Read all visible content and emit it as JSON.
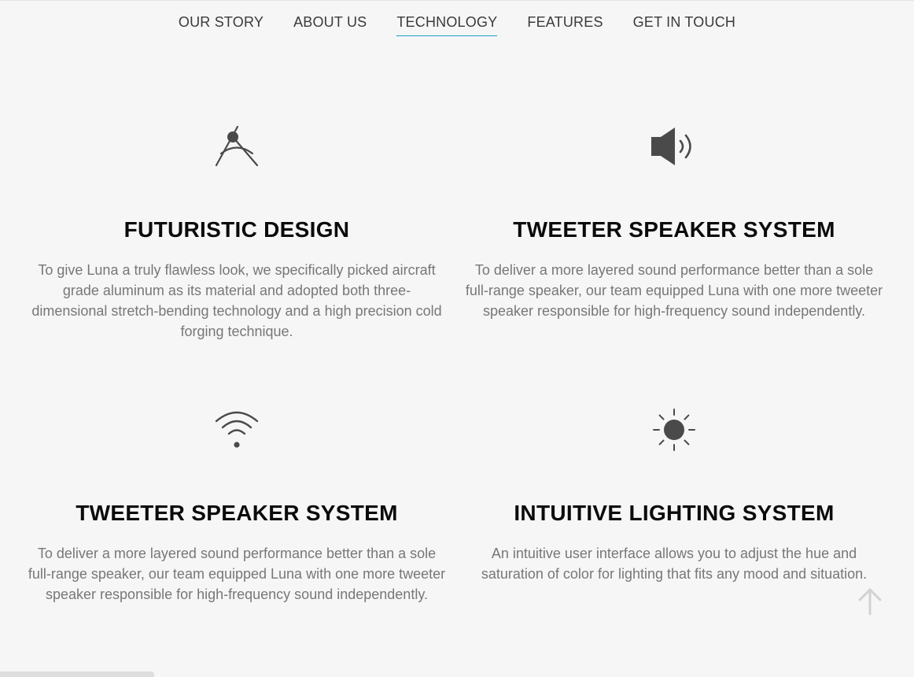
{
  "nav": {
    "items": [
      {
        "label": "OUR STORY"
      },
      {
        "label": "ABOUT US"
      },
      {
        "label": "TECHNOLOGY",
        "active": true
      },
      {
        "label": "FEATURES"
      },
      {
        "label": "GET IN TOUCH"
      }
    ]
  },
  "features": [
    {
      "icon": "compass-icon",
      "title": "FUTURISTIC DESIGN",
      "text": "To give Luna a truly flawless look, we specifically picked aircraft grade aluminum as its material and adopted both three-dimensional stretch-bending technology and a high precision cold forging technique."
    },
    {
      "icon": "speaker-icon",
      "title": "TWEETER SPEAKER SYSTEM",
      "text": "To deliver a more layered sound performance better than a sole full-range speaker, our team equipped Luna with one more tweeter speaker responsible for high-frequency sound independently."
    },
    {
      "icon": "wifi-icon",
      "title": "TWEETER SPEAKER SYSTEM",
      "text": "To deliver a more layered sound performance better than a sole full-range speaker, our team equipped Luna with one more tweeter speaker responsible for high-frequency sound independently."
    },
    {
      "icon": "sun-icon",
      "title": "INTUITIVE LIGHTING SYSTEM",
      "text": "An intuitive user interface allows you to adjust the hue and saturation of color for lighting that fits any mood and situation."
    }
  ],
  "colors": {
    "background": "#f6f6f6",
    "accent": "#1a9fbd",
    "icon": "#4a4a4a",
    "title": "#0b0b0b",
    "body_text": "#777777"
  }
}
